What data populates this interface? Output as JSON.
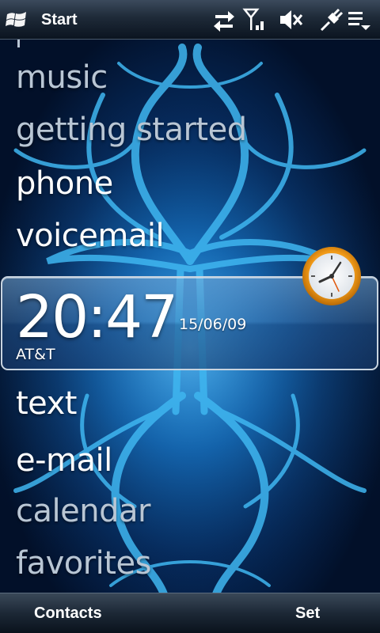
{
  "status_bar": {
    "start_label": "Start",
    "icons": [
      "windows-flag-icon",
      "data-sync-icon",
      "signal-strength-icon",
      "speaker-muted-icon",
      "power-plug-icon",
      "menu-chevron-icon"
    ]
  },
  "menu": {
    "items_top": [
      {
        "label": "music",
        "style": "dim"
      },
      {
        "label": "getting started",
        "style": "dim"
      },
      {
        "label": "phone",
        "style": "bright"
      },
      {
        "label": "voicemail",
        "style": "bright"
      }
    ],
    "items_bottom": [
      {
        "label": "text",
        "style": "bright"
      },
      {
        "label": "e-mail",
        "style": "bright"
      },
      {
        "label": "calendar",
        "style": "dim"
      },
      {
        "label": "favorites",
        "style": "dim"
      }
    ]
  },
  "clock": {
    "time": "20:47",
    "date": "15/06/09",
    "carrier": "AT&T",
    "icon": "analog-clock-icon"
  },
  "softkeys": {
    "left": "Contacts",
    "right": "Set"
  },
  "colors": {
    "background_deep": "#021029",
    "background_glow": "#1a7fd0",
    "tribal_pattern": "#3fb6f0",
    "text_bright": "#ffffff",
    "text_dim": "#b9c6d4",
    "clock_face_orange": "#f0a020"
  }
}
